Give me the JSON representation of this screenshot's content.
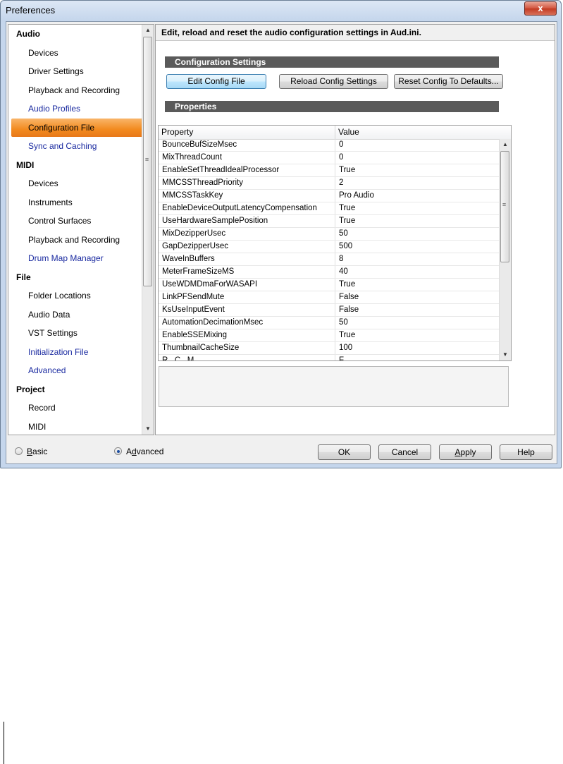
{
  "window": {
    "title": "Preferences",
    "close_glyph": "x"
  },
  "sidebar": {
    "items": [
      {
        "label": "Audio",
        "type": "header"
      },
      {
        "label": "Devices",
        "type": "item"
      },
      {
        "label": "Driver Settings",
        "type": "item"
      },
      {
        "label": "Playback and Recording",
        "type": "item"
      },
      {
        "label": "Audio Profiles",
        "type": "advanced"
      },
      {
        "label": "Configuration File",
        "type": "selected"
      },
      {
        "label": "Sync and Caching",
        "type": "advanced"
      },
      {
        "label": "MIDI",
        "type": "header"
      },
      {
        "label": "Devices",
        "type": "item"
      },
      {
        "label": "Instruments",
        "type": "item"
      },
      {
        "label": "Control Surfaces",
        "type": "item"
      },
      {
        "label": "Playback and Recording",
        "type": "item"
      },
      {
        "label": "Drum Map Manager",
        "type": "advanced"
      },
      {
        "label": "File",
        "type": "header"
      },
      {
        "label": "Folder Locations",
        "type": "item"
      },
      {
        "label": "Audio Data",
        "type": "item"
      },
      {
        "label": "VST Settings",
        "type": "item"
      },
      {
        "label": "Initialization File",
        "type": "advanced"
      },
      {
        "label": "Advanced",
        "type": "advanced"
      },
      {
        "label": "Project",
        "type": "header"
      },
      {
        "label": "Record",
        "type": "item"
      },
      {
        "label": "MIDI",
        "type": "item"
      }
    ]
  },
  "main": {
    "description": "Edit, reload and reset the audio configuration settings in Aud.ini.",
    "config_section_title": "Configuration Settings",
    "buttons": {
      "edit": "Edit Config File",
      "reload": "Reload Config Settings",
      "reset": "Reset Config To Defaults..."
    },
    "properties_section_title": "Properties",
    "grid": {
      "headers": {
        "property": "Property",
        "value": "Value"
      },
      "rows": [
        {
          "property": "BounceBufSizeMsec",
          "value": "0"
        },
        {
          "property": "MixThreadCount",
          "value": "0"
        },
        {
          "property": "EnableSetThreadIdealProcessor",
          "value": "True"
        },
        {
          "property": "MMCSSThreadPriority",
          "value": "2"
        },
        {
          "property": "MMCSSTaskKey",
          "value": "Pro Audio"
        },
        {
          "property": "EnableDeviceOutputLatencyCompensation",
          "value": "True"
        },
        {
          "property": "UseHardwareSamplePosition",
          "value": "True"
        },
        {
          "property": "MixDezipperUsec",
          "value": "50"
        },
        {
          "property": "GapDezipperUsec",
          "value": "500"
        },
        {
          "property": "WaveInBuffers",
          "value": "8"
        },
        {
          "property": "MeterFrameSizeMS",
          "value": "40"
        },
        {
          "property": "UseWDMDmaForWASAPI",
          "value": "True"
        },
        {
          "property": "LinkPFSendMute",
          "value": "False"
        },
        {
          "property": "KsUseInputEvent",
          "value": "False"
        },
        {
          "property": "AutomationDecimationMsec",
          "value": "50"
        },
        {
          "property": "EnableSSEMixing",
          "value": "True"
        },
        {
          "property": "ThumbnailCacheSize",
          "value": "100"
        },
        {
          "property": "R...C...M...",
          "value": "F..."
        }
      ]
    }
  },
  "footer": {
    "mode_basic": {
      "prefix": "",
      "accel": "B",
      "suffix": "asic",
      "selected": false
    },
    "mode_advanced": {
      "prefix": "A",
      "accel": "d",
      "suffix": "vanced",
      "selected": true
    },
    "ok": "OK",
    "cancel": "Cancel",
    "apply_accel": "A",
    "apply_rest": "pply",
    "help": "Help"
  }
}
